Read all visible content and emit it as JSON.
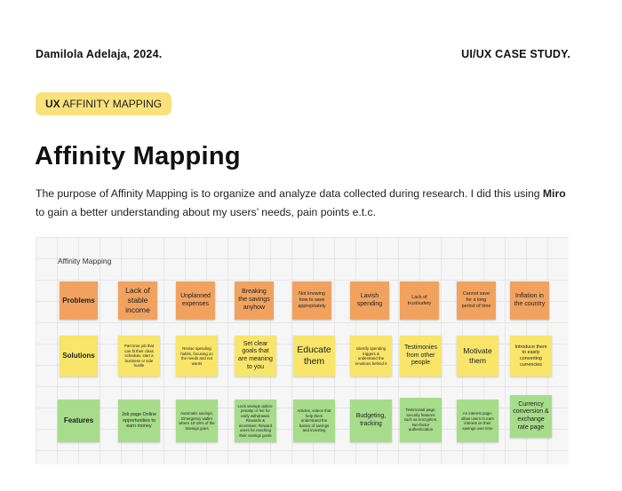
{
  "header": {
    "author": "Damilola Adelaja, 2024.",
    "case_study": "UI/UX CASE STUDY."
  },
  "badge": {
    "strong": "UX",
    "rest": " AFFINITY MAPPING"
  },
  "title": "Affinity Mapping",
  "intro": {
    "part1": "The purpose of Affinity Mapping is to organize and analyze data collected during research. I did this using ",
    "bold": "Miro",
    "part2": " to gain a better understanding about my users’ needs, pain points e.t.c."
  },
  "board": {
    "title": "Affinity Mapping",
    "row_labels": [
      "Problems",
      "Solutions",
      "Features"
    ],
    "problems": [
      "Lack of stable income",
      "Unplanned expenses",
      "Breaking the savings anyhow",
      "Not knowing how to save appropriately",
      "Lavish spending",
      "Lack of trust/safety",
      "Cannot save for a long period of time",
      "Inflation in the country"
    ],
    "solutions": [
      "Part time job that can fit their class schedule, start a business or side hustle",
      "Revise spending habits, focusing on the needs and not wants",
      "Set clear goals that are meaning to you",
      "Educate them",
      "Identify spending triggers & understand the emotions behind it",
      "Testimonies from other people",
      "Motivate them",
      "Introduce them to easily converting currencies"
    ],
    "features": [
      "Job page Online opportunities to earn money",
      "Automatic savings, Emergency wallet where 10-15% of the Savings goes",
      "Lock savings option-penalty or fee for early withdrawal. Rewards & incentives: Reward users for reaching their savings goals",
      "Articles, videos that help them understand the basics of savings and investing",
      "Budgeting, tracking",
      "Testimonial page, security features such as encryption, two-factor authentication",
      "An interest page-allow users to earn interest on their savings over time",
      "Currency conversion & exchange rate page"
    ]
  },
  "colors": {
    "badge": "#f9e27c",
    "problem_note": "#f1a25f",
    "solution_note": "#f8e56a",
    "feature_note": "#a6dc8a"
  }
}
